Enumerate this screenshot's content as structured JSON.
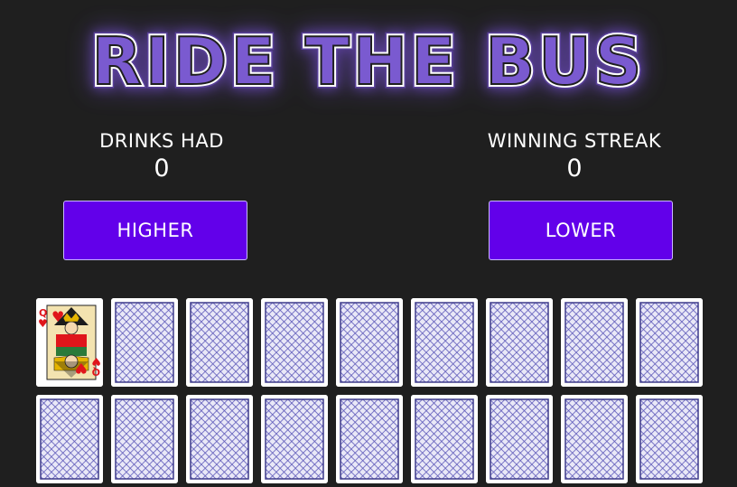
{
  "title": "RIDE THE BUS",
  "stats": {
    "drinks_label": "DRINKS HAD",
    "drinks_value": "0",
    "streak_label": "WINNING STREAK",
    "streak_value": "0"
  },
  "buttons": {
    "higher": "HIGHER",
    "lower": "LOWER"
  },
  "colors": {
    "background": "#1f1f1f",
    "button": "#6200ea",
    "glow": "#8a5cff",
    "card_back": "#5b57b8",
    "suit_red": "#e0151b"
  },
  "cards": {
    "face_up": {
      "rank": "Q",
      "suit": "hearts"
    },
    "rows": [
      [
        "face-up",
        "back",
        "back",
        "back",
        "back",
        "back",
        "back",
        "back",
        "back"
      ],
      [
        "back",
        "back",
        "back",
        "back",
        "back",
        "back",
        "back",
        "back",
        "back"
      ]
    ]
  }
}
